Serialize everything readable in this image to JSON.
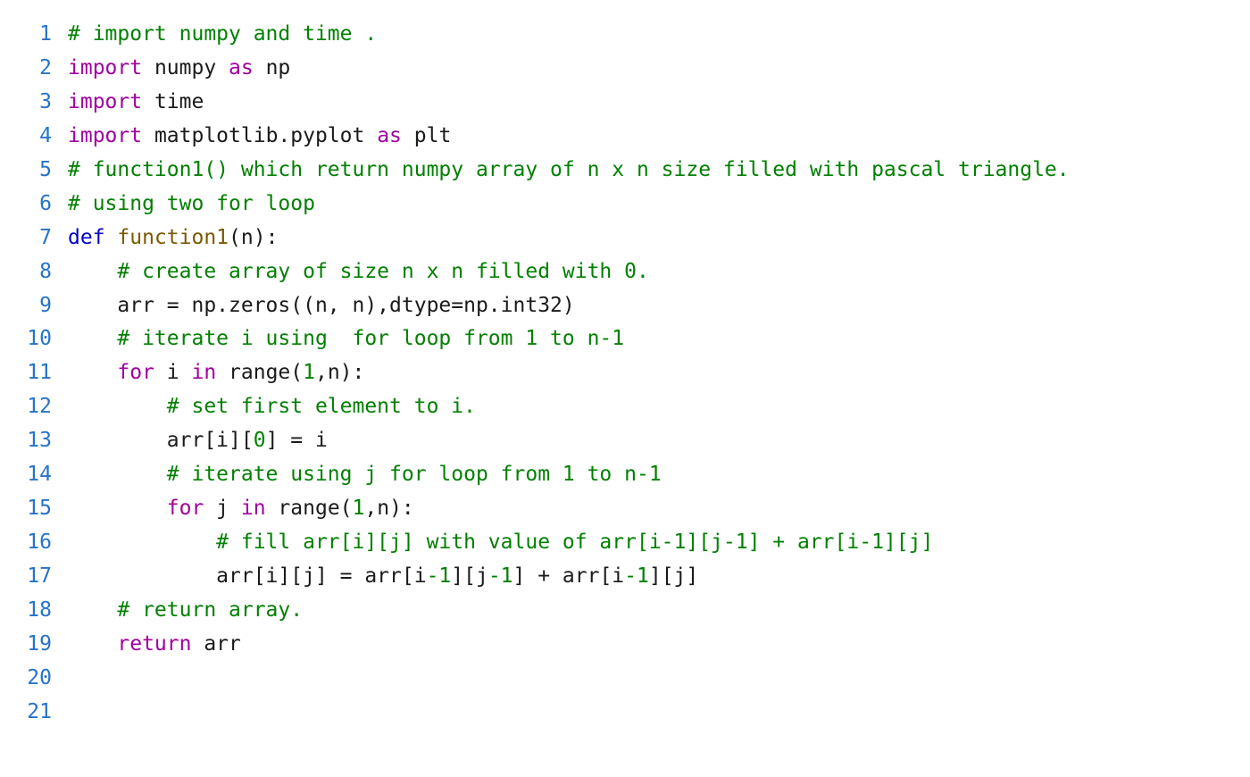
{
  "language": "python",
  "colors": {
    "comment": "#008000",
    "keyword": "#a000a0",
    "def": "#0000c8",
    "funcname": "#7a5a00",
    "default": "#1a1a1a",
    "number": "#008000",
    "gutter": "#2673c9",
    "background": "#ffffff"
  },
  "lines": [
    {
      "n": 1,
      "tokens": [
        [
          "comment",
          "# import numpy and time ."
        ]
      ]
    },
    {
      "n": 2,
      "tokens": [
        [
          "keyword",
          "import"
        ],
        [
          "default",
          " numpy "
        ],
        [
          "keyword",
          "as"
        ],
        [
          "default",
          " np"
        ]
      ]
    },
    {
      "n": 3,
      "tokens": [
        [
          "keyword",
          "import"
        ],
        [
          "default",
          " time"
        ]
      ]
    },
    {
      "n": 4,
      "tokens": [
        [
          "keyword",
          "import"
        ],
        [
          "default",
          " matplotlib.pyplot "
        ],
        [
          "keyword",
          "as"
        ],
        [
          "default",
          " plt"
        ]
      ]
    },
    {
      "n": 5,
      "tokens": [
        [
          "comment",
          "# function1() which return numpy array of n x n size filled with pascal triangle."
        ]
      ]
    },
    {
      "n": 6,
      "tokens": [
        [
          "comment",
          "# using two for loop"
        ]
      ]
    },
    {
      "n": 7,
      "tokens": [
        [
          "def",
          "def"
        ],
        [
          "default",
          " "
        ],
        [
          "funcname",
          "function1"
        ],
        [
          "default",
          "(n):"
        ]
      ]
    },
    {
      "n": 8,
      "tokens": [
        [
          "default",
          "    "
        ],
        [
          "comment",
          "# create array of size n x n filled with 0."
        ]
      ]
    },
    {
      "n": 9,
      "tokens": [
        [
          "default",
          "    arr = np.zeros((n, n),dtype=np.int32)"
        ]
      ]
    },
    {
      "n": 10,
      "tokens": [
        [
          "default",
          "    "
        ],
        [
          "comment",
          "# iterate i using  for loop from 1 to n-1"
        ]
      ]
    },
    {
      "n": 11,
      "tokens": [
        [
          "default",
          "    "
        ],
        [
          "keyword",
          "for"
        ],
        [
          "default",
          " i "
        ],
        [
          "keyword",
          "in"
        ],
        [
          "default",
          " range("
        ],
        [
          "number",
          "1"
        ],
        [
          "default",
          ",n):"
        ]
      ]
    },
    {
      "n": 12,
      "tokens": [
        [
          "default",
          "        "
        ],
        [
          "comment",
          "# set first element to i."
        ]
      ]
    },
    {
      "n": 13,
      "tokens": [
        [
          "default",
          "        arr[i]["
        ],
        [
          "number",
          "0"
        ],
        [
          "default",
          "] = i"
        ]
      ]
    },
    {
      "n": 14,
      "tokens": [
        [
          "default",
          "        "
        ],
        [
          "comment",
          "# iterate using j for loop from 1 to n-1"
        ]
      ]
    },
    {
      "n": 15,
      "tokens": [
        [
          "default",
          "        "
        ],
        [
          "keyword",
          "for"
        ],
        [
          "default",
          " j "
        ],
        [
          "keyword",
          "in"
        ],
        [
          "default",
          " range("
        ],
        [
          "number",
          "1"
        ],
        [
          "default",
          ",n):"
        ]
      ]
    },
    {
      "n": 16,
      "tokens": [
        [
          "default",
          "            "
        ],
        [
          "comment",
          "# fill arr[i][j] with value of arr[i-1][j-1] + arr[i-1][j]"
        ]
      ]
    },
    {
      "n": 17,
      "tokens": [
        [
          "default",
          "            arr[i][j] = arr[i"
        ],
        [
          "number",
          "-1"
        ],
        [
          "default",
          "][j"
        ],
        [
          "number",
          "-1"
        ],
        [
          "default",
          "] + arr[i"
        ],
        [
          "number",
          "-1"
        ],
        [
          "default",
          "][j]"
        ]
      ]
    },
    {
      "n": 18,
      "tokens": [
        [
          "default",
          "    "
        ],
        [
          "comment",
          "# return array."
        ]
      ]
    },
    {
      "n": 19,
      "tokens": [
        [
          "default",
          "    "
        ],
        [
          "keyword",
          "return"
        ],
        [
          "default",
          " arr"
        ]
      ]
    },
    {
      "n": 20,
      "tokens": [
        [
          "default",
          ""
        ]
      ]
    },
    {
      "n": 21,
      "tokens": [
        [
          "default",
          ""
        ]
      ]
    }
  ]
}
